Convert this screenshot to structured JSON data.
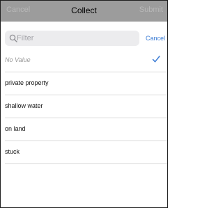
{
  "nav": {
    "cancel_label": "Cancel",
    "title": "Collect",
    "submit_label": "Submit"
  },
  "search": {
    "placeholder": "Filter",
    "value": "",
    "cancel_label": "Cancel"
  },
  "options": [
    {
      "label": "No Value",
      "selected": true,
      "style": "placeholder"
    },
    {
      "label": "private property",
      "selected": false
    },
    {
      "label": "shallow water",
      "selected": false
    },
    {
      "label": "on land",
      "selected": false
    },
    {
      "label": "stuck",
      "selected": false
    }
  ],
  "colors": {
    "nav_background": "#9c9c9c",
    "accent": "#3a7bd5",
    "search_background": "#ececee"
  },
  "icons": {
    "search": "search-icon",
    "selected": "checkmark-icon"
  }
}
